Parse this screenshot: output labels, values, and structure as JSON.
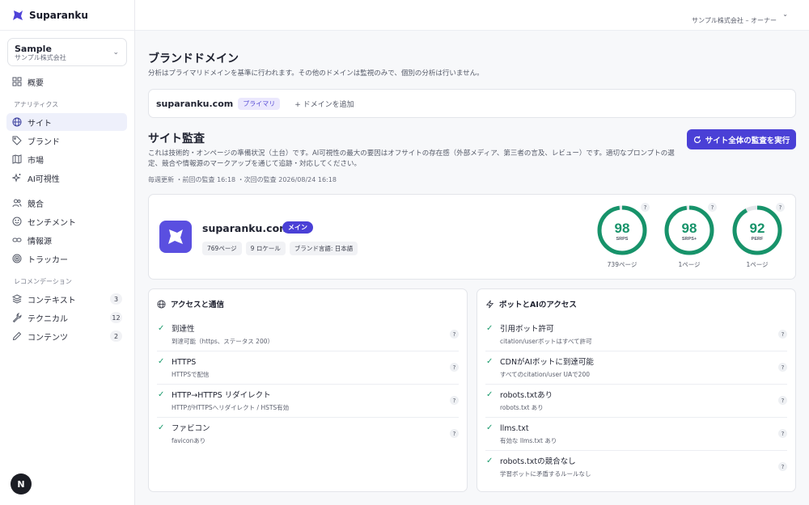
{
  "app": {
    "name": "Suparanku"
  },
  "org": {
    "name": "Sample",
    "company": "サンプル株式会社"
  },
  "account": {
    "label": "サンプル株式会社 – オーナー"
  },
  "sidebar": {
    "overview": "概要",
    "analytics_section": "アナリティクス",
    "analytics": [
      {
        "label": "サイト",
        "icon": "globe-icon",
        "active": true
      },
      {
        "label": "ブランド",
        "icon": "tag-icon"
      },
      {
        "label": "市場",
        "icon": "map-icon"
      },
      {
        "label": "AI可視性",
        "icon": "sparkles-icon"
      }
    ],
    "insights": [
      {
        "label": "競合",
        "icon": "users-icon"
      },
      {
        "label": "センチメント",
        "icon": "smile-icon"
      },
      {
        "label": "情報源",
        "icon": "link-icon"
      },
      {
        "label": "トラッカー",
        "icon": "target-icon"
      }
    ],
    "recommend_section": "レコメンデーション",
    "recommend": [
      {
        "label": "コンテキスト",
        "icon": "layers-icon",
        "badge": "3"
      },
      {
        "label": "テクニカル",
        "icon": "wrench-icon",
        "badge": "12"
      },
      {
        "label": "コンテンツ",
        "icon": "pen-icon",
        "badge": "2"
      }
    ],
    "fab_label": "N"
  },
  "brand_domain": {
    "title": "ブランドドメイン",
    "description": "分析はプライマリドメインを基準に行われます。その他のドメインは監視のみで、個別の分析は行いません。",
    "domain": "suparanku.com",
    "primary_badge": "プライマリ",
    "add_label": "+ ドメインを追加"
  },
  "audit": {
    "title": "サイト監査",
    "description": "これは技術的・オンページの準備状況（土台）です。AI可視性の最大の要因はオフサイトの存在感（外部メディア、第三者の言及、レビュー）です。適切なプロンプトの選定、競合や情報源のマークアップを通じて追跡・対応してください。",
    "meta": "毎週更新 ・前回の監査 16:18 ・次回の監査 2026/08/24 16:18",
    "run_button": "サイト全体の監査を実行"
  },
  "site": {
    "name": "suparanku.com",
    "badge": "メイン",
    "tags": [
      "769ページ",
      "9 ロケール",
      "ブランド言語: 日本語"
    ],
    "gauges": [
      {
        "value": "98",
        "label": "SRPS",
        "pages": "739ページ",
        "fraction": 0.98,
        "color": "#17936a"
      },
      {
        "value": "98",
        "label": "SRPS+",
        "pages": "1ページ",
        "fraction": 0.98,
        "color": "#17936a"
      },
      {
        "value": "92",
        "label": "PERF",
        "pages": "1ページ",
        "fraction": 0.92,
        "color": "#17936a"
      }
    ]
  },
  "access_card": {
    "title": "アクセスと通信",
    "items": [
      {
        "title": "到達性",
        "sub": "到達可能（https、ステータス 200）"
      },
      {
        "title": "HTTPS",
        "sub": "HTTPSで配信"
      },
      {
        "title": "HTTP→HTTPS リダイレクト",
        "sub": "HTTPがHTTPSへリダイレクト / HSTS有効"
      },
      {
        "title": "ファビコン",
        "sub": "faviconあり"
      }
    ]
  },
  "bot_card": {
    "title": "ボットとAIのアクセス",
    "items": [
      {
        "title": "引用ボット許可",
        "sub": "citation/userボットはすべて許可"
      },
      {
        "title": "CDNがAIボットに到達可能",
        "sub": "すべてのcitation/user UAで200"
      },
      {
        "title": "robots.txtあり",
        "sub": "robots.txt あり"
      },
      {
        "title": "llms.txt",
        "sub": "有効な llms.txt あり"
      },
      {
        "title": "robots.txtの競合なし",
        "sub": "学習ボットに矛盾するルールなし"
      }
    ]
  },
  "colors": {
    "accent": "#4a40d6",
    "success": "#17936a"
  }
}
